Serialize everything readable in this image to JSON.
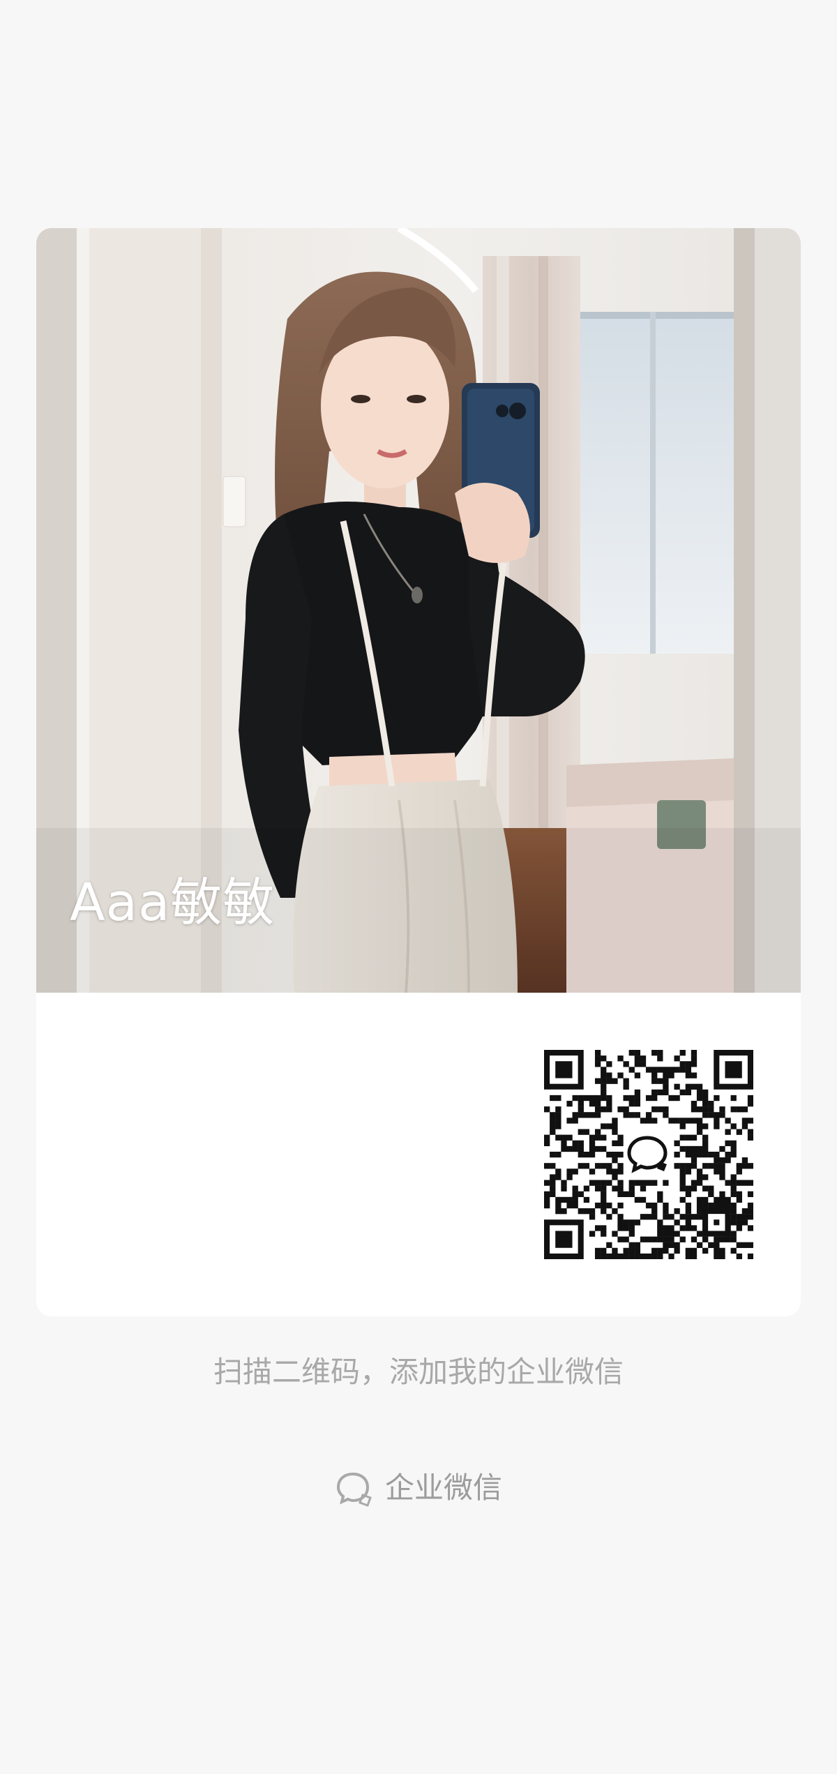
{
  "card": {
    "name": "Aaa敏敏"
  },
  "hint_text": "扫描二维码，添加我的企业微信",
  "brand": {
    "label": "企业微信",
    "icon": "wecom-chat-icon"
  },
  "colors": {
    "page_bg": "#f7f7f7",
    "card_bg": "#ffffff",
    "hint_text": "#a8a8a8",
    "brand_text": "#9c9c9c"
  }
}
